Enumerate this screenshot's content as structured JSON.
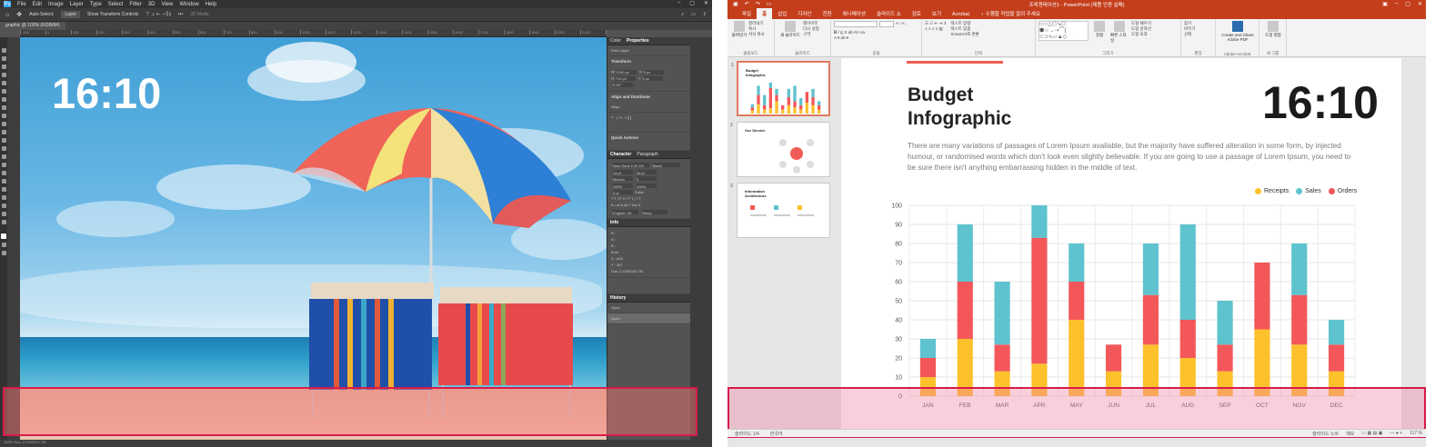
{
  "photoshop": {
    "logo": "Ps",
    "menu": [
      "File",
      "Edit",
      "Image",
      "Layer",
      "Type",
      "Select",
      "Filter",
      "3D",
      "View",
      "Window",
      "Help"
    ],
    "options": {
      "auto_select": "Auto-Select:",
      "layer": "Layer",
      "transform": "Show Transform Controls",
      "mode": "3D Mode:"
    },
    "doc_tab": "graphic @ 100% (RGB/8#)",
    "ruler": [
      "-100",
      "0",
      "100",
      "200",
      "300",
      "400",
      "500",
      "600",
      "700",
      "800",
      "900",
      "1000",
      "1100",
      "1200",
      "1300",
      "1400",
      "1500",
      "1600",
      "1700",
      "1800",
      "1900",
      "2000",
      "2100",
      "2200"
    ],
    "canvas_text": "16:10",
    "panels": {
      "tab_color": "Color",
      "tab_properties": "Properties",
      "pixel_layer": "Pixel Layer",
      "transform": "Transform",
      "w": "W",
      "w_val": "1280 px",
      "h": "H",
      "h_val": "720 px",
      "x": "X",
      "x_val": "0 px",
      "y": "Y",
      "y_val": "0 px",
      "angle": "0.00°",
      "align": "Align and Distribute",
      "align_sub": "Align:",
      "quick": "Quick Actions",
      "tab_character": "Character",
      "tab_paragraph": "Paragraph",
      "font": "Noto Sans CJK KR",
      "font_style": "Black",
      "size": "18 pt",
      "leading": "36 pt",
      "kern": "Metrics",
      "tracking": "0",
      "vscale": "100%",
      "hscale": "100%",
      "baseline": "0 pt",
      "color_lbl": "Color:",
      "lang": "English: UK",
      "aa": "Sharp",
      "tab_info": "Info",
      "info_r": "R :",
      "info_g": "G :",
      "info_b": "B :",
      "info_8": "8-bit",
      "info_x": "X :",
      "info_x_v": "628",
      "info_y": "Y :",
      "info_y_v": "307",
      "info_doc": "Doc: 2.47M/224.7M",
      "tab_history": "History",
      "hist_doc": "Open",
      "hist_item": "Open"
    },
    "status": "100%   Doc: 2.47M/224.7M"
  },
  "powerpoint": {
    "title": "프레젠테이션1 - PowerPoint (제품 인증 실패)",
    "tabs": [
      "파일",
      "홈",
      "삽입",
      "디자인",
      "전환",
      "애니메이션",
      "슬라이드 쇼",
      "검토",
      "보기",
      "Acrobat",
      "♀ 수행할 작업을 알려 주세요"
    ],
    "active_tab": "홈",
    "ribbon": {
      "paste": "붙여넣기",
      "clip_lines": [
        "잘라내기",
        "복사",
        "서식 복사"
      ],
      "clip_group": "클립보드",
      "new_slide": "새 슬라이드",
      "slide_lines": [
        "레이아웃",
        "다시 설정",
        "구역"
      ],
      "slide_group": "슬라이드",
      "font_group": "글꼴",
      "para_lines": [
        "텍스트 방향",
        "텍스트 맞춤",
        "SmartArt로 변환"
      ],
      "para_group": "단락",
      "arrange": "정렬",
      "quick_styles": "빠른 스타일",
      "draw_lines": [
        "도형 채우기",
        "도형 윤곽선",
        "도형 효과"
      ],
      "draw_group": "그리기",
      "edit_lines": [
        "찾기",
        "바꾸기",
        "선택"
      ],
      "edit_group": "편집",
      "acrobat_btn": "Create and Share Adobe PDF",
      "acrobat_group": "Adobe Acrobat",
      "misc_btn": "도형 병합",
      "misc_group": "새 그룹"
    },
    "thumbs": [
      {
        "num": "1",
        "title": "Budget Infographic"
      },
      {
        "num": "2",
        "title": "Our Service"
      },
      {
        "num": "3",
        "title": "Information Architecture"
      }
    ],
    "slide": {
      "title": "Budget\nInfographic",
      "ratio": "16:10",
      "body": "There are many variations of passages of Lorem Ipsum available, but the majority have suffered alteration in some form, by injected humour, or randomised words which don't look even slightly believable. If you are going to use a passage of Lorem Ipsum, you need to be sure there isn't anything embarrassing hidden in the middle of text."
    },
    "status": {
      "slide": "슬라이드 1/4",
      "lang": "한국어",
      "notes": "슬라이드 노트",
      "comments": "메모",
      "zoom": "117 %"
    }
  },
  "chart_data": {
    "type": "bar",
    "stacked": true,
    "categories": [
      "JAN",
      "FEB",
      "MAR",
      "APR",
      "MAY",
      "JUN",
      "JUL",
      "AUG",
      "SEP",
      "OCT",
      "NOV",
      "DEC"
    ],
    "series": [
      {
        "name": "Receipts",
        "color": "#fdc12c",
        "values": [
          10,
          30,
          13,
          17,
          40,
          13,
          27,
          20,
          13,
          35,
          27,
          13
        ]
      },
      {
        "name": "Orders",
        "color": "#f3575a",
        "values": [
          10,
          30,
          14,
          66,
          20,
          14,
          26,
          20,
          14,
          35,
          26,
          14
        ]
      },
      {
        "name": "Sales",
        "color": "#5ec3ce",
        "values": [
          10,
          30,
          33,
          17,
          20,
          0,
          27,
          50,
          23,
          0,
          27,
          13
        ]
      }
    ],
    "legend_order": [
      "Receipts",
      "Sales",
      "Orders"
    ],
    "ylim": [
      0,
      100
    ],
    "yticks": [
      0,
      10,
      20,
      30,
      40,
      50,
      60,
      70,
      80,
      90,
      100
    ],
    "grid": true,
    "legend": "top-right"
  }
}
